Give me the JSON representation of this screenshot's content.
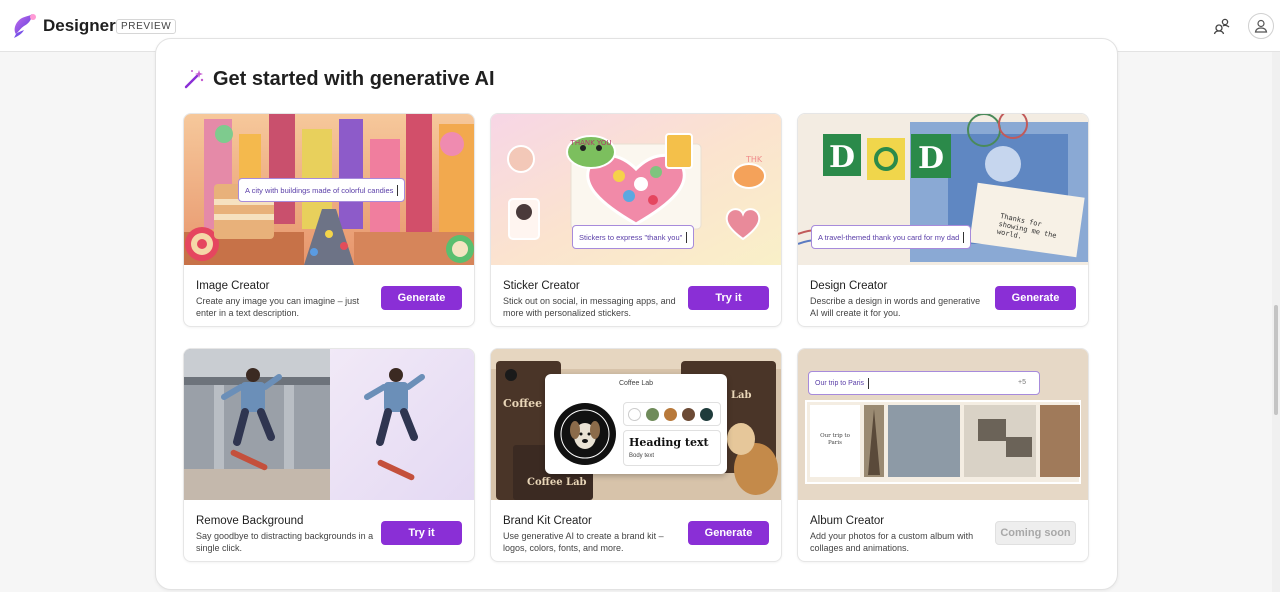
{
  "header": {
    "brand": "Designer",
    "badge": "PREVIEW",
    "share_icon": "people-share-icon",
    "profile_icon": "person-icon"
  },
  "section": {
    "heading": "Get started with generative AI",
    "heading_icon": "magic-wand-icon"
  },
  "cards": [
    {
      "title": "Image Creator",
      "description": "Create any image you can imagine – just enter in a text description.",
      "button": "Generate",
      "prompt": "A city with buildings made of colorful candies"
    },
    {
      "title": "Sticker Creator",
      "description": "Stick out on social, in messaging apps, and more with personalized stickers.",
      "button": "Try it",
      "prompt": "Stickers to express \"thank you\""
    },
    {
      "title": "Design Creator",
      "description": "Describe a design in words and generative AI will create it for you.",
      "button": "Generate",
      "prompt": "A travel-themed thank you card for my dad",
      "note": "Thanks for showing me the world."
    },
    {
      "title": "Remove Background",
      "description": "Say goodbye to distracting backgrounds in a single click.",
      "button": "Try it"
    },
    {
      "title": "Brand Kit Creator",
      "description": "Use generative AI to create a brand kit – logos, colors, fonts, and more.",
      "button": "Generate",
      "kit_title": "Coffee Lab",
      "kit_heading": "Heading text",
      "kit_body": "Body text",
      "bg_text_1": "Coffee Lab",
      "bg_text_2": "Coffee Lab",
      "bg_text_3": "Lab"
    },
    {
      "title": "Album Creator",
      "description": "Add your photos for a custom album with collages and animations.",
      "button": "Coming soon",
      "prompt": "Our trip to Paris",
      "more_count": "+5",
      "caption": "Our trip to Paris"
    }
  ],
  "colors": {
    "accent": "#8a2fd6",
    "disabled_button": "#eeeeee",
    "prompt_border": "#a78bdb",
    "kit_swatches": [
      "#ffffff",
      "#6f8b5a",
      "#b8793a",
      "#6b4a35",
      "#1f3b3b"
    ]
  }
}
